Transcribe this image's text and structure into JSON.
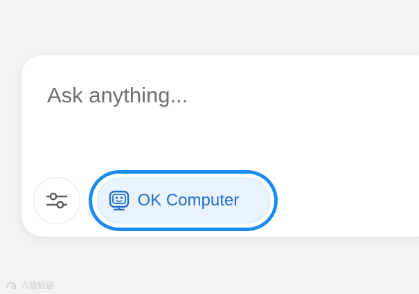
{
  "composer": {
    "placeholder": "Ask anything...",
    "settings_icon": "sliders-icon",
    "mode_button": {
      "label": "OK Computer",
      "icon": "robot-face-icon",
      "state": "selected",
      "accent_color": "#1a8cf0",
      "text_color": "#1f6fd0"
    }
  },
  "watermark": {
    "text": "六级短语"
  }
}
